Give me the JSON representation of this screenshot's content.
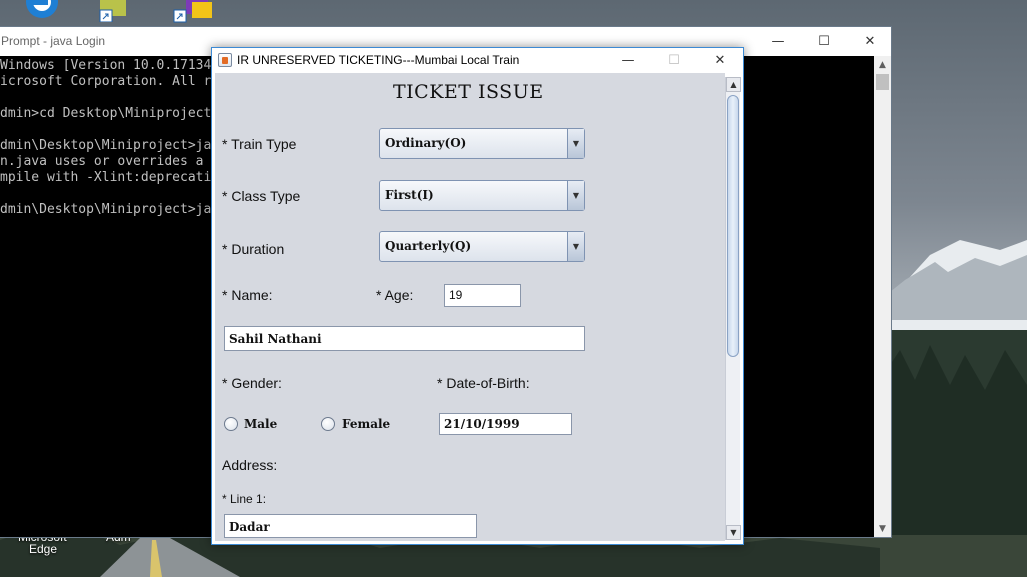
{
  "desktop": {
    "edge_label_line1": "Microsoft",
    "edge_label_line2": "Edge",
    "other_label": "Adm"
  },
  "cmd": {
    "title": "Prompt - java  Login",
    "lines": [
      "Windows [Version 10.0.17134",
      "icrosoft Corporation. All r",
      "",
      "dmin>cd Desktop\\Miniproject",
      "",
      "dmin\\Desktop\\Miniproject>ja",
      "n.java uses or overrides a",
      "mpile with -Xlint:deprecati",
      "",
      "dmin\\Desktop\\Miniproject>ja"
    ]
  },
  "app": {
    "title": "IR UNRESERVED TICKETING---Mumbai Local Train",
    "heading": "TICKET ISSUE",
    "train_type": {
      "label": "* Train Type",
      "value": "Ordinary(O)"
    },
    "class_type": {
      "label": "* Class Type",
      "value": "First(I)"
    },
    "duration": {
      "label": "* Duration",
      "value": "Quarterly(Q)"
    },
    "name": {
      "label": "* Name:",
      "value": "Sahil Nathani"
    },
    "age": {
      "label": "* Age:",
      "value": "19"
    },
    "gender": {
      "label": "* Gender:",
      "options": [
        "Male",
        "Female"
      ],
      "selected": null
    },
    "dob": {
      "label": "* Date-of-Birth:",
      "value": "21/10/1999"
    },
    "address": {
      "label": "Address:",
      "line1_label": "* Line 1:",
      "line1_value": "Dadar"
    }
  },
  "icons": {
    "minimize": "—",
    "maximize": "☐",
    "close": "✕",
    "dropdown": "▼",
    "scroll_up": "▲",
    "scroll_down": "▼"
  }
}
